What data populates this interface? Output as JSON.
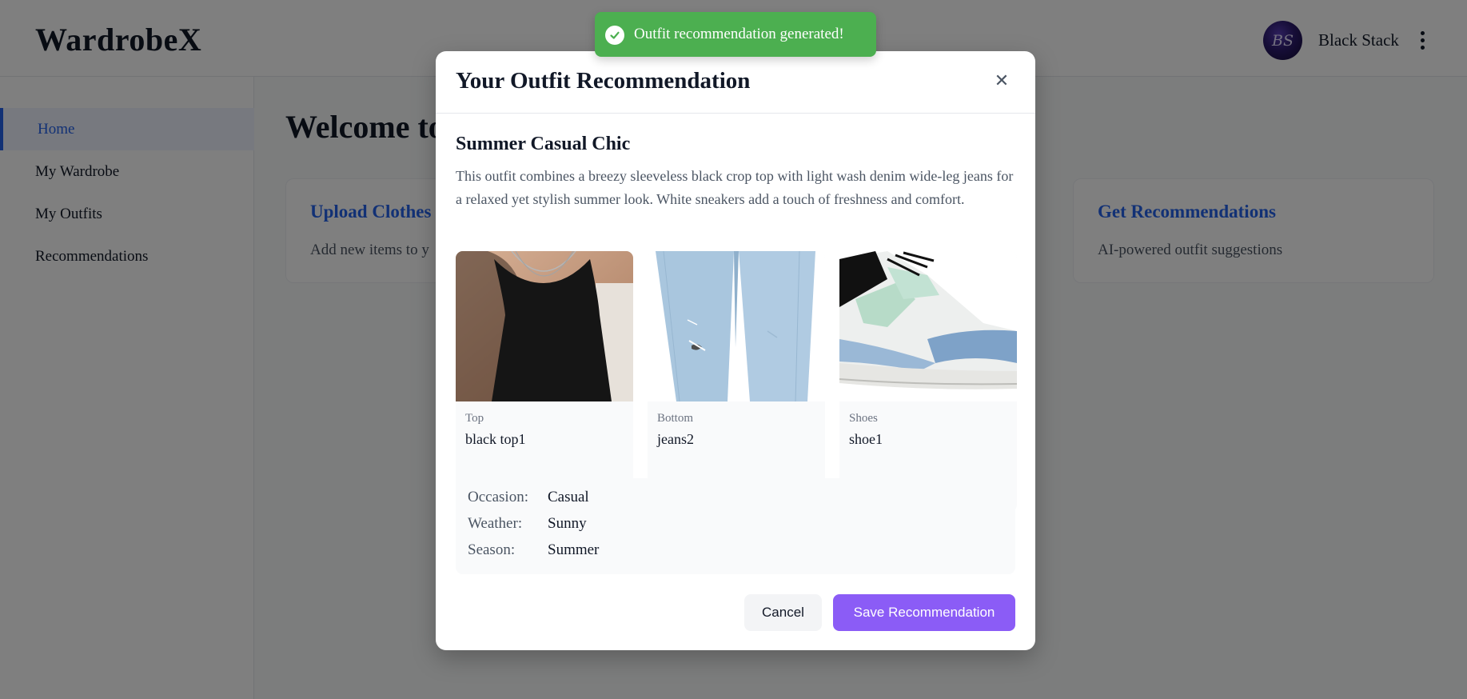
{
  "app": {
    "logo": "WardrobeX",
    "user_name": "Black Stack",
    "avatar_initials": "BS"
  },
  "sidebar": {
    "items": [
      {
        "label": "Home",
        "active": true
      },
      {
        "label": "My Wardrobe",
        "active": false
      },
      {
        "label": "My Outfits",
        "active": false
      },
      {
        "label": "Recommendations",
        "active": false
      }
    ]
  },
  "main": {
    "welcome_title": "Welcome to",
    "cards": [
      {
        "title": "Upload Clothes",
        "description": "Add new items to y"
      },
      {
        "title": "Get Recommendations",
        "description": "AI-powered outfit suggestions"
      }
    ]
  },
  "toast": {
    "message": "Outfit recommendation generated!",
    "color": "#4caf50",
    "icon": "check-icon"
  },
  "modal": {
    "title": "Your Outfit Recommendation",
    "close_icon": "close-icon",
    "outfit_name": "Summer Casual Chic",
    "outfit_description": "This outfit combines a breezy sleeveless black crop top with light wash denim wide-leg jeans for a relaxed yet stylish summer look. White sneakers add a touch of freshness and comfort.",
    "items": [
      {
        "type": "Top",
        "name": "black top1",
        "image": "black sleeveless top"
      },
      {
        "type": "Bottom",
        "name": "jeans2",
        "image": "light wash jeans"
      },
      {
        "type": "Shoes",
        "name": "shoe1",
        "image": "white sneaker with mint and blue"
      }
    ],
    "details": [
      {
        "label": "Occasion:",
        "value": "Casual"
      },
      {
        "label": "Weather:",
        "value": "Sunny"
      },
      {
        "label": "Season:",
        "value": "Summer"
      }
    ],
    "cancel_label": "Cancel",
    "save_label": "Save Recommendation",
    "accent_color": "#8b5cf6"
  }
}
